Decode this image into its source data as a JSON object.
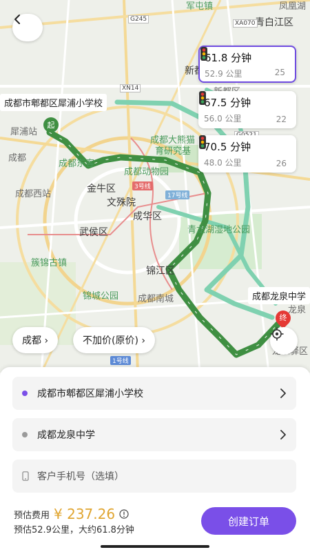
{
  "map": {
    "labels": [
      {
        "text": "军屯镇",
        "class": "green"
      },
      {
        "text": "青白江区",
        "class": "dark"
      },
      {
        "text": "凤凰湖",
        "class": ""
      },
      {
        "text": "新都",
        "class": "dark"
      },
      {
        "text": "新都区",
        "class": ""
      },
      {
        "text": "犀浦站",
        "class": ""
      },
      {
        "text": "成都大熊猫",
        "class": "green"
      },
      {
        "text": "育研究基",
        "class": "green"
      },
      {
        "text": "成都东客",
        "class": "green"
      },
      {
        "text": "成都动物园",
        "class": "green"
      },
      {
        "text": "金牛区",
        "class": "dark"
      },
      {
        "text": "成都西站",
        "class": ""
      },
      {
        "text": "文殊院",
        "class": "dark"
      },
      {
        "text": "成华区",
        "class": "dark"
      },
      {
        "text": "武侯区",
        "class": "dark"
      },
      {
        "text": "青龙湖湿地公园",
        "class": "green"
      },
      {
        "text": "簇锦古镇",
        "class": "green"
      },
      {
        "text": "锦江区",
        "class": "dark"
      },
      {
        "text": "锦城公园",
        "class": "green"
      },
      {
        "text": "成都南城",
        "class": ""
      },
      {
        "text": "龙泉",
        "class": ""
      },
      {
        "text": "成都",
        "class": ""
      },
      {
        "text": "龙泉驿区",
        "class": ""
      }
    ],
    "road_shields": [
      "G245",
      "XA070",
      "XN14",
      "G0521"
    ],
    "metro_lines": [
      "3号线",
      "17号线",
      "1号线"
    ]
  },
  "routes": [
    {
      "time": "61.8 分钟",
      "distance": "52.9 公里",
      "lights": "25",
      "selected": true
    },
    {
      "time": "67.5 分钟",
      "distance": "56.0 公里",
      "lights": "22",
      "selected": false
    },
    {
      "time": "70.5 分钟",
      "distance": "48.0 公里",
      "lights": "26",
      "selected": false
    }
  ],
  "markers": {
    "start_tag": "成都市郫都区犀浦小学校",
    "start_badge": "起",
    "end_tag": "成都龙泉中学",
    "end_badge": "终"
  },
  "pills": {
    "city": "成都 ›",
    "price": "不加价(原价) ›"
  },
  "form": {
    "origin": "成都市郫都区犀浦小学校",
    "destination": "成都龙泉中学",
    "phone_placeholder": "客户手机号（选填）"
  },
  "fee": {
    "label": "预估费用",
    "value": "¥ 237.26",
    "summary": "预估52.9公里，大约61.8分钟"
  },
  "create_button": "创建订单",
  "colors": {
    "accent": "#7a4fe8",
    "route": "#3f8f42",
    "alt_route": "#7fd1b0",
    "fee": "#e0a530"
  }
}
